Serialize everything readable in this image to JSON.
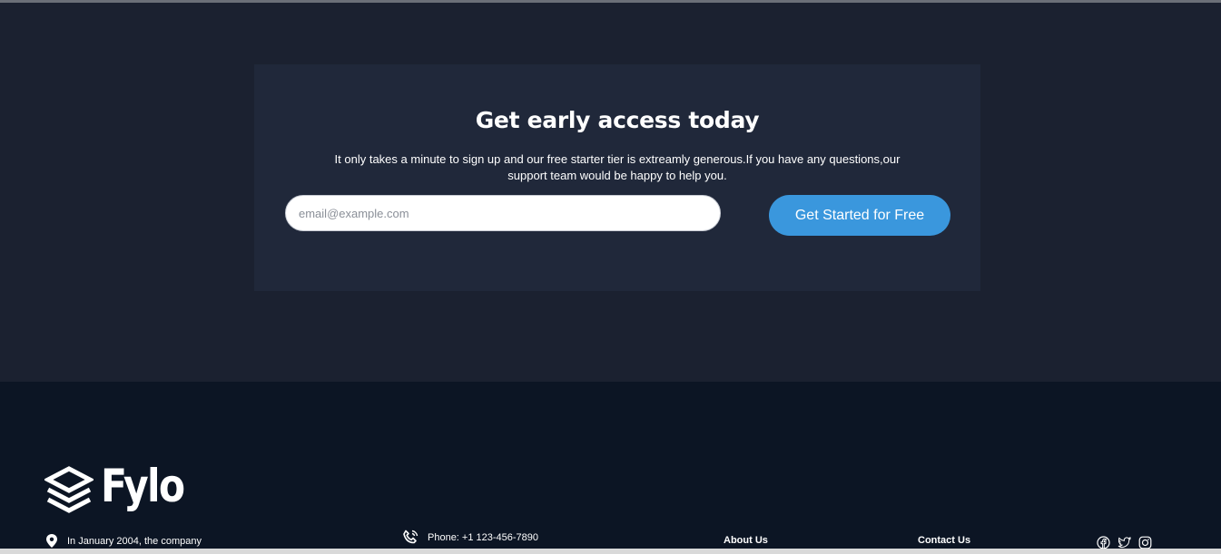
{
  "cta": {
    "title": "Get early access today",
    "description": "It only takes a minute to sign up and our free starter tier is extreamly generous.If you have any questions,our support team would be happy to help you.",
    "email_placeholder": "email@example.com",
    "email_value": "",
    "button_label": "Get Started for Free"
  },
  "footer": {
    "logo_text": "Fylo",
    "location_text": "In January 2004, the company",
    "phone_text": "Phone: +1 123-456-7890",
    "links": [
      "About Us",
      "Contact Us"
    ],
    "socials": [
      "facebook-icon",
      "twitter-icon",
      "instagram-icon"
    ]
  },
  "colors": {
    "page_bg": "#1b2130",
    "card_bg": "#20283a",
    "footer_bg": "#0c1524",
    "button": "#3a97dd"
  }
}
